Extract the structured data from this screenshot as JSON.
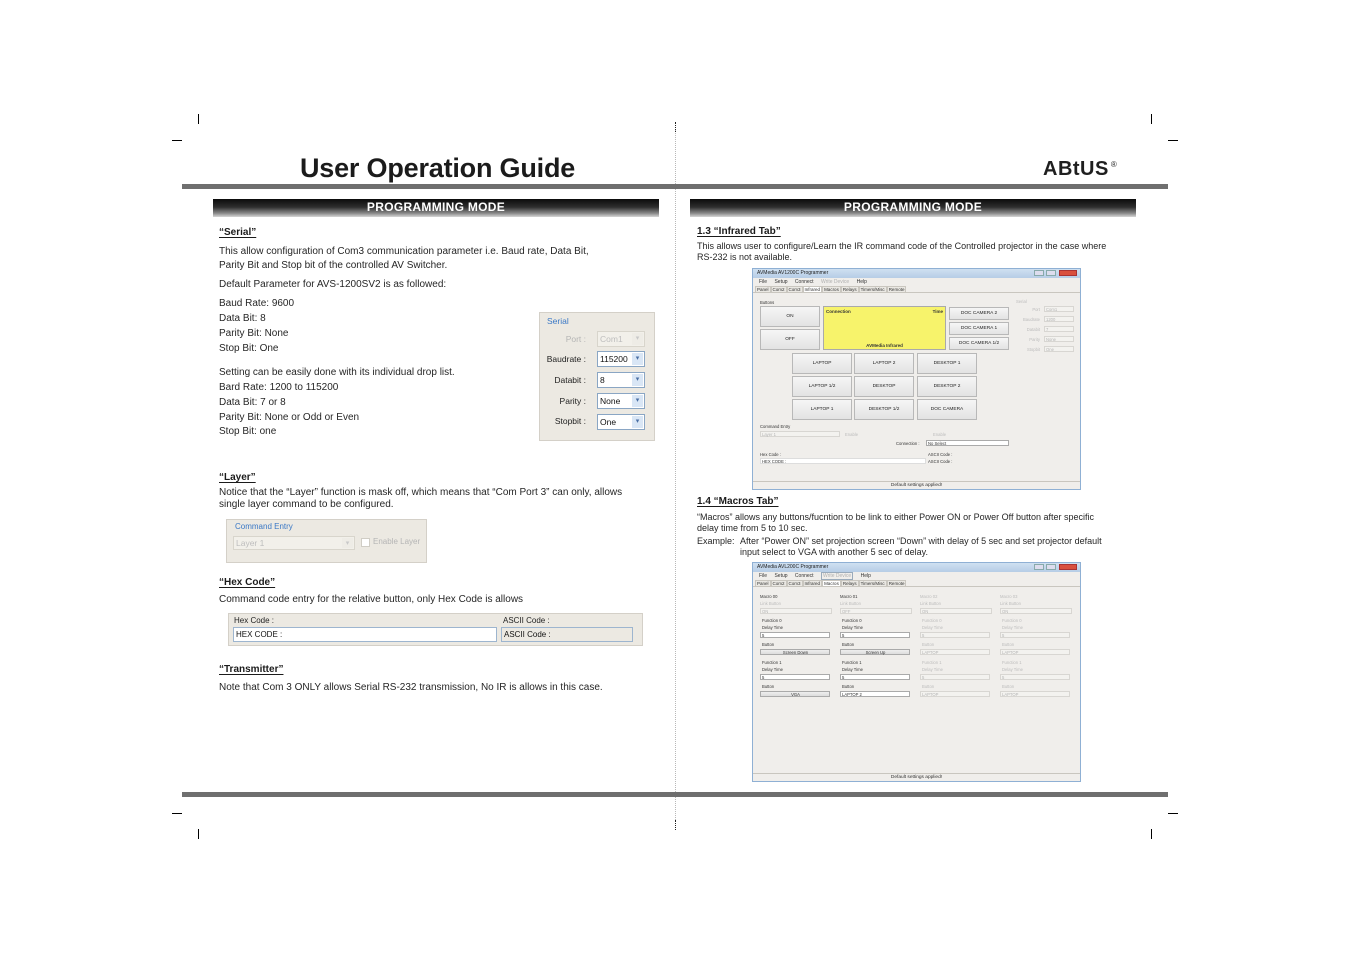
{
  "header": {
    "title": "User Operation Guide",
    "logo_text": "ABtUS",
    "logo_mark": "®"
  },
  "left_page": {
    "section_bar": "PROGRAMMING MODE",
    "serial": {
      "heading": "“Serial”",
      "intro_1": "This allow configuration of Com3 communication parameter i.e. Baud rate, Data Bit,",
      "intro_2": "Parity Bit and Stop bit of the controlled AV Switcher.",
      "default_intro": "Default Parameter for AVS-1200SV2 is as followed:",
      "defaults": [
        "Baud Rate: 9600",
        "Data Bit: 8",
        "Parity Bit: None",
        "Stop Bit: One"
      ],
      "options_intro": "Setting can be easily done with its individual drop list.",
      "options": [
        "Bard Rate: 1200 to 115200",
        "Data Bit: 7 or 8",
        "Parity Bit: None or Odd or Even",
        "Stop Bit: one"
      ],
      "panel": {
        "legend": "Serial",
        "fields": [
          {
            "label": "Port :",
            "value": "Com1",
            "disabled": true
          },
          {
            "label": "Baudrate :",
            "value": "115200",
            "disabled": false
          },
          {
            "label": "Databit :",
            "value": "8",
            "disabled": false
          },
          {
            "label": "Parity :",
            "value": "None",
            "disabled": false
          },
          {
            "label": "Stopbit :",
            "value": "One",
            "disabled": false
          }
        ]
      }
    },
    "layer": {
      "heading": "“Layer”",
      "text_1": "Notice that the “Layer” function is mask off, which means that “Com Port 3” can only, allows",
      "text_2": "single layer command to be configured.",
      "panel": {
        "legend": "Command Entry",
        "layer_value": "Layer 1",
        "checkbox_label": "Enable Layer"
      }
    },
    "hex": {
      "heading": "“Hex Code”",
      "text": "Command code entry for the relative button, only Hex Code is allows",
      "panel": {
        "hex_label": "Hex Code :",
        "hex_value": "HEX CODE :",
        "ascii_label": "ASCII Code :",
        "ascii_value": "ASCII Code :"
      }
    },
    "transmitter": {
      "heading": "“Transmitter”",
      "text": "Note that Com 3 ONLY allows Serial RS-232 transmission, No IR is allows in this case."
    }
  },
  "right_page": {
    "section_bar": "PROGRAMMING MODE",
    "infrared": {
      "heading": "1.3 “Infrared Tab”",
      "text_1": "This allows user to configure/Learn the IR command code of the Controlled projector in the case where",
      "text_2": "RS-232 is not available.",
      "window": {
        "title": "AVMedia AV1200C Programmer",
        "menu": [
          "File",
          "Setup",
          "Connect",
          "Write Device",
          "Help"
        ],
        "tabs": [
          "Panel",
          "Com2",
          "Com3",
          "Infrared",
          "Macros",
          "Relays",
          "Timers/Misc",
          "Remote"
        ],
        "active_tab": "Infrared",
        "buttons_label": "Buttons",
        "on_label": "ON",
        "off_label": "OFF",
        "display_connection": "Connection",
        "display_time": "Time",
        "display_footer": "AVMedia Infrared",
        "doc_buttons": [
          "DOC CAMERA 2",
          "DOC CAMERA 1",
          "DOC CAMERA 1/2"
        ],
        "grid_buttons": [
          "LAPTOP",
          "LAPTOP 2",
          "DESKTOP 1",
          "LAPTOP 1/2",
          "DESKTOP",
          "DESKTOP 2",
          "LAPTOP 1",
          "DESKTOP 1/2",
          "DOC CAMERA"
        ],
        "serial_legend": "Serial",
        "serial_fields": [
          {
            "label": "Port",
            "value": "Com1"
          },
          {
            "label": "Baudrate",
            "value": "1200"
          },
          {
            "label": "Databit",
            "value": "7"
          },
          {
            "label": "Parity",
            "value": "None"
          },
          {
            "label": "Stopbit",
            "value": "One"
          }
        ],
        "command_entry": "Command Entry",
        "layer_value": "Layer 1",
        "enable_label": "Enable",
        "enable_label_2": "Enable",
        "connection_label": "Connection :",
        "connection_value": "No Select",
        "hex_label": "Hex Code :",
        "hex_value": "HEX CODE :",
        "ascii_label": "ASCII Code :",
        "ascii_value": "ASCII Code :",
        "status": "Default settings applied!"
      }
    },
    "macros": {
      "heading": "1.4 “Macros Tab”",
      "text_1": "“Macros” allows any buttons/fucntion to be link to either Power ON or Power Off button after specific",
      "text_2": "delay time from 5 to 10 sec.",
      "example_label": "Example:",
      "example_1": "After “Power ON” set projection screen “Down” with delay of 5 sec and set projector default",
      "example_2": "input select to VGA with another 5 sec of delay.",
      "window": {
        "title": "AVMedia AVL200C Programmer",
        "menu": [
          "File",
          "Setup",
          "Connect",
          "Write Device",
          "Help"
        ],
        "tabs": [
          "Panel",
          "Com2",
          "Com3",
          "Infrared",
          "Macros",
          "Relays",
          "Timers/Misc",
          "Remote"
        ],
        "active_tab": "Macros",
        "link_button_label": "Link Button",
        "function_0": "Function 0",
        "function_1": "Function 1",
        "delay_label": "Delay Time",
        "button_label": "Button",
        "macros": [
          {
            "name": "Macro 00",
            "link": "ON",
            "f0_delay": "5",
            "f0_button": "Screen Down",
            "f1_delay": "5",
            "f1_button": "VGA",
            "enabled": true
          },
          {
            "name": "Macro 01",
            "link": "OFF",
            "f0_delay": "5",
            "f0_button": "Screen Up",
            "f1_delay": "5",
            "f1_button": "LAPTOP 2",
            "enabled": true
          },
          {
            "name": "Macro 02",
            "link": "ON",
            "f0_delay": "5",
            "f0_button": "LAPTOP",
            "f1_delay": "5",
            "f1_button": "LAPTOP",
            "enabled": false
          },
          {
            "name": "Macro 03",
            "link": "ON",
            "f0_delay": "5",
            "f0_button": "LAPTOP",
            "f1_delay": "5",
            "f1_button": "LAPTOP",
            "enabled": false
          }
        ],
        "status": "Default settings applied!"
      }
    }
  }
}
